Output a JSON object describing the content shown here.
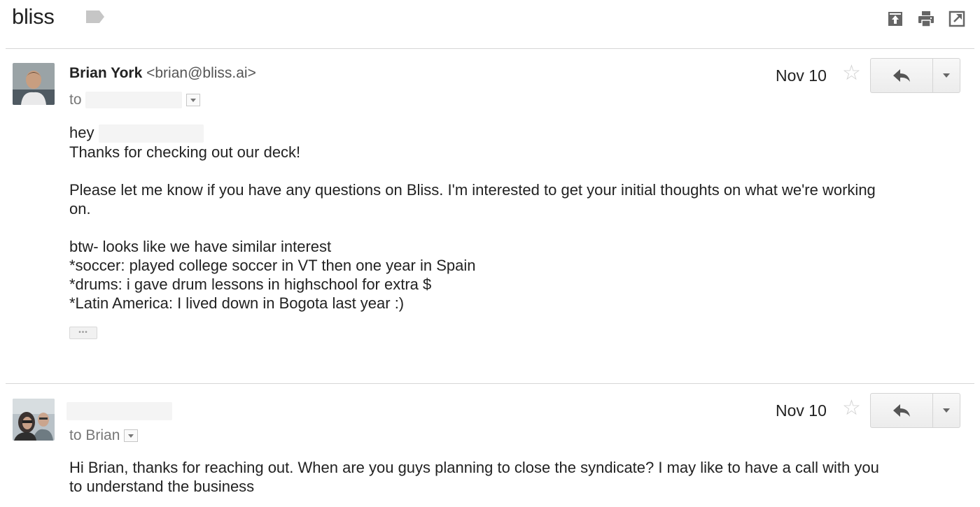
{
  "thread": {
    "subject": "bliss",
    "icons": {
      "label": "label-icon",
      "move": "move-to-inbox-icon",
      "print": "print-icon",
      "popout": "new-window-icon"
    }
  },
  "messages": [
    {
      "sender_name": "Brian York",
      "sender_email": "<brian@bliss.ai>",
      "to_prefix": "to",
      "date": "Nov 10",
      "star": "☆",
      "body": {
        "greeting": "hey",
        "lines": [
          "Thanks for checking out our deck!",
          "",
          "Please let me know if you have any questions on Bliss. I'm interested to get your initial thoughts on what we're working",
          "on.",
          "",
          "btw- looks like we have similar interest",
          "*soccer: played college soccer in VT then one year in Spain",
          "*drums: i gave drum lessons in highschool for extra $",
          "*Latin America: I lived down in Bogota last year :)"
        ],
        "trimmed_marker": "•••"
      }
    },
    {
      "to_line": "to Brian",
      "date": "Nov 10",
      "star": "☆",
      "body": {
        "lines": [
          "Hi Brian, thanks for reaching out. When are you guys planning to close the syndicate? I may like to have a call with you",
          "to understand the business"
        ]
      }
    }
  ]
}
